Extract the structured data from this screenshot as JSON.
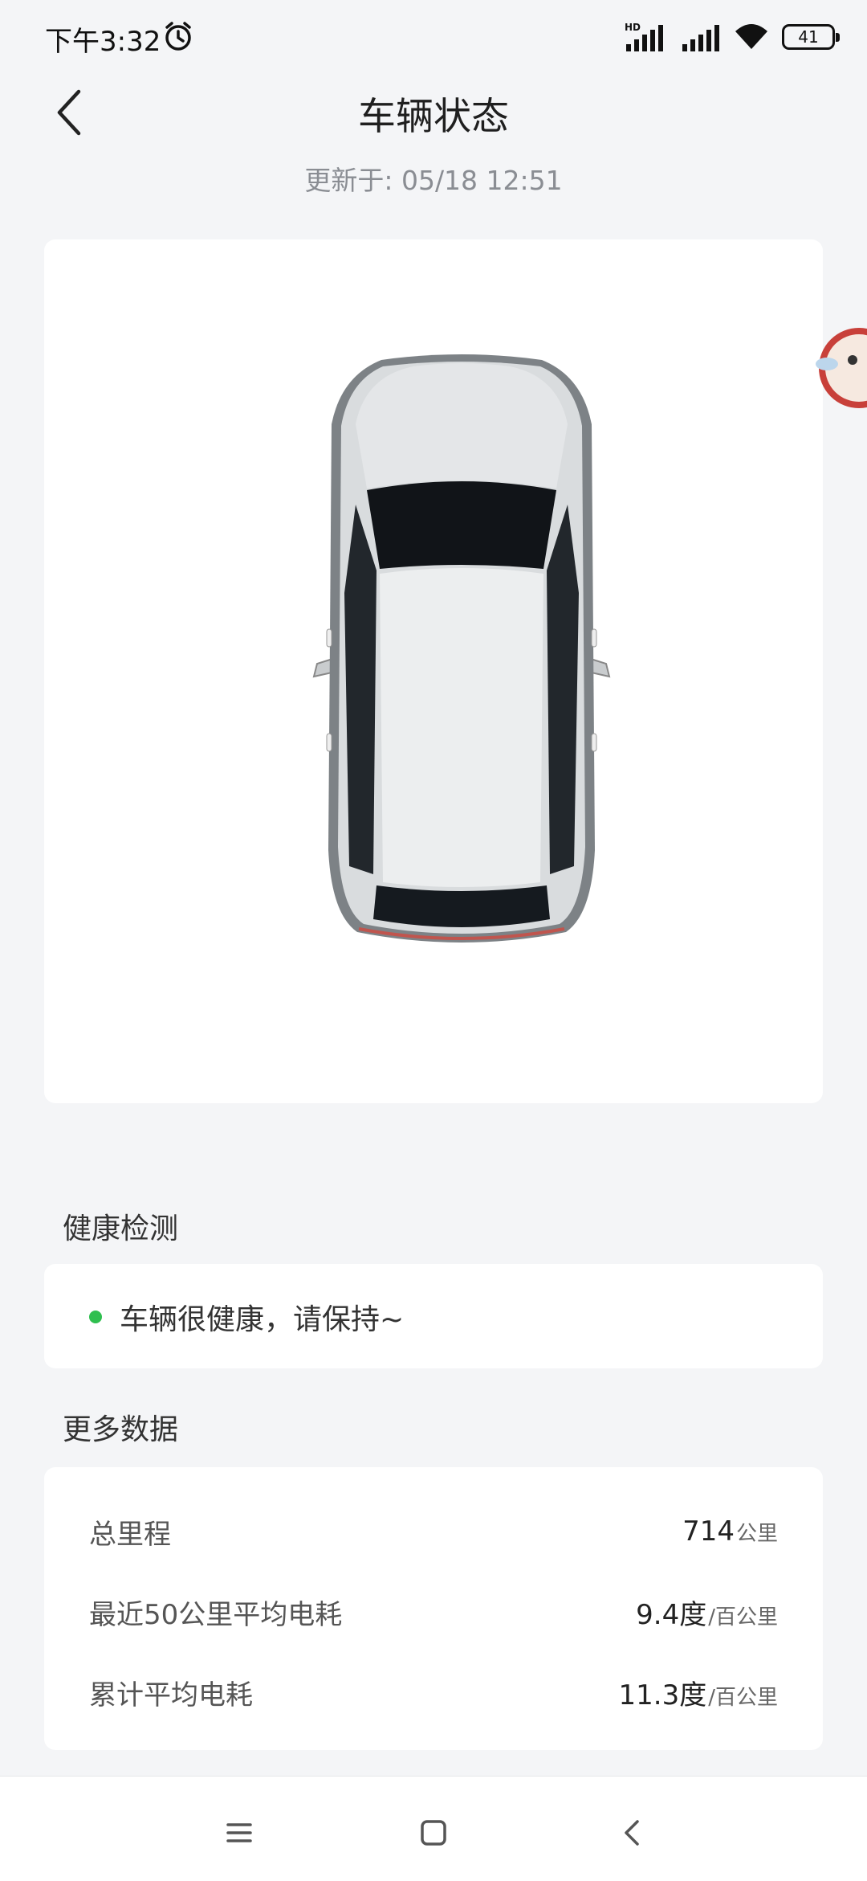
{
  "status_bar": {
    "time": "下午3:32",
    "battery": "41",
    "icons": [
      "alarm-icon",
      "hd-signal-icon",
      "signal-icon",
      "wifi-icon",
      "battery-icon"
    ]
  },
  "header": {
    "title": "车辆状态",
    "updated": "更新于: 05/18 12:51"
  },
  "health": {
    "section_title": "健康检测",
    "status_text": "车辆很健康，请保持~",
    "status_color": "#2fbf4f"
  },
  "more_data": {
    "section_title": "更多数据",
    "rows": [
      {
        "label": "总里程",
        "value": "714",
        "unit": "公里"
      },
      {
        "label": "最近50公里平均电耗",
        "value": "9.4度",
        "unit": "/百公里"
      },
      {
        "label": "累计平均电耗",
        "value": "11.3度",
        "unit": "/百公里"
      }
    ]
  },
  "nav": {
    "icons": [
      "menu-icon",
      "home-icon",
      "back-icon"
    ]
  }
}
